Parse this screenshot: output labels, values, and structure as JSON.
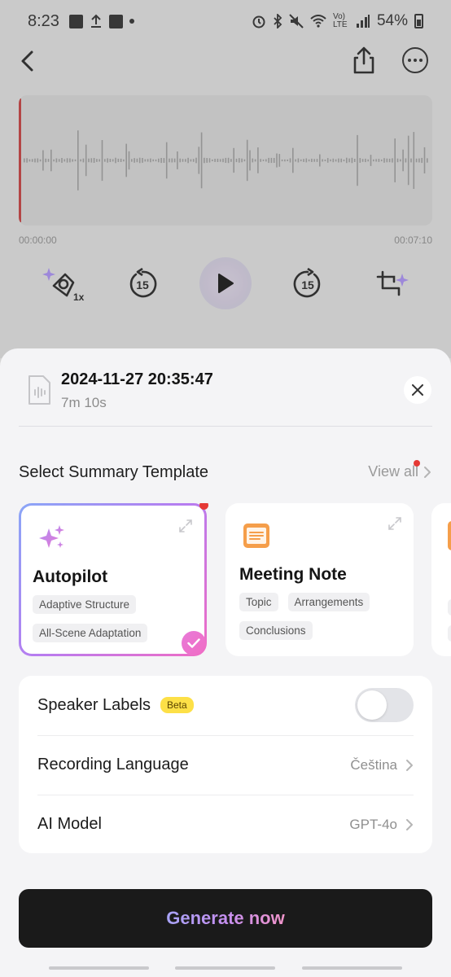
{
  "status_bar": {
    "time": "8:23",
    "network": "Vo) LTE",
    "battery": "54%"
  },
  "player": {
    "time_start": "00:00:00",
    "time_end": "00:07:10",
    "speed_label": "1x",
    "skip_back_seconds": "15",
    "skip_forward_seconds": "15"
  },
  "sheet": {
    "recording_title": "2024-11-27 20:35:47",
    "recording_duration": "7m 10s",
    "section_title": "Select Summary Template",
    "view_all": "View all",
    "templates": [
      {
        "title": "Autopilot",
        "tags": [
          "Adaptive Structure",
          "All-Scene Adaptation"
        ],
        "selected": true
      },
      {
        "title": "Meeting Note",
        "tags": [
          "Topic",
          "Arrangements",
          "Conclusions"
        ],
        "selected": false
      }
    ],
    "settings": {
      "speaker_labels": "Speaker Labels",
      "beta": "Beta",
      "speaker_labels_on": false,
      "recording_language": "Recording Language",
      "recording_language_value": "Čeština",
      "ai_model": "AI Model",
      "ai_model_value": "GPT-4o"
    },
    "generate_label": "Generate now"
  },
  "colors": {
    "accent_red": "#e53935",
    "beta_yellow": "#fde047",
    "button_dark": "#1a1a1a",
    "template_orange": "#f59e4a"
  }
}
